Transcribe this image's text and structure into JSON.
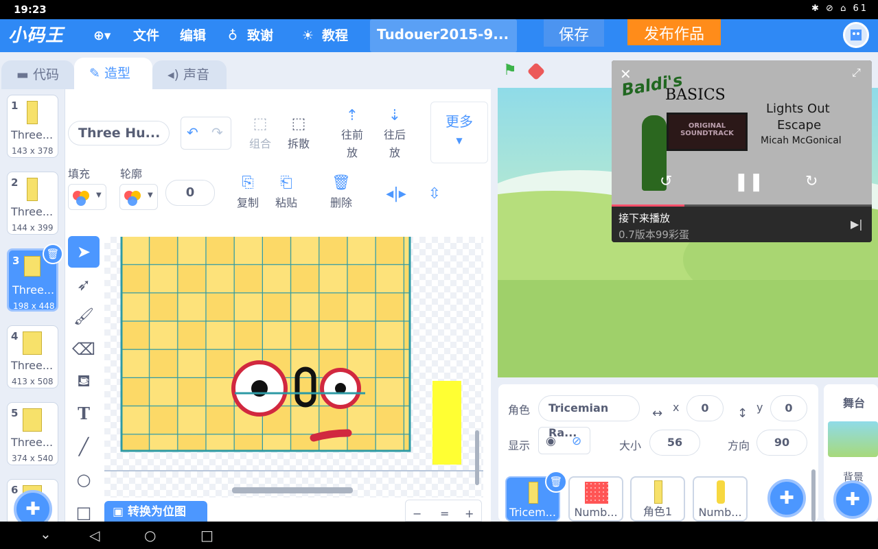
{
  "status": {
    "time": "19:23",
    "icons_text": "✱ ⊘ ⌂ 61"
  },
  "menu": {
    "logo": "小码王",
    "file": "文件",
    "edit": "编辑",
    "credits": "致谢",
    "tutorial": "教程",
    "project_title": "Tudouer2015-9...",
    "save": "保存",
    "publish": "发布作品"
  },
  "tabs": {
    "code": "代码",
    "costume": "造型",
    "sound": "声音"
  },
  "costumes": [
    {
      "num": "1",
      "name": "Three...",
      "size": "143 x 378"
    },
    {
      "num": "2",
      "name": "Three...",
      "size": "144 x 399"
    },
    {
      "num": "3",
      "name": "Three...",
      "size": "198 x 448"
    },
    {
      "num": "4",
      "name": "Three...",
      "size": "413 x 508"
    },
    {
      "num": "5",
      "name": "Three...",
      "size": "374 x 540"
    },
    {
      "num": "6",
      "name": "",
      "size": ""
    }
  ],
  "editor": {
    "costume_name": "Three Hu...",
    "group": "组合",
    "ungroup": "拆散",
    "forward": "往前",
    "backward": "往后",
    "put": "放",
    "more": "更多",
    "fill": "填充",
    "outline": "轮廓",
    "outline_width": "0",
    "copy": "复制",
    "paste": "粘贴",
    "delete": "删除",
    "convert": "转换为位图",
    "zoom_out": "−",
    "zoom_reset": "=",
    "zoom_in": "+"
  },
  "video": {
    "title_line1": "Baldi's",
    "title_line2": "BASICS",
    "soundtrack": "ORIGINAL SOUNDTRACK",
    "track_line1": "Lights Out",
    "track_line2": "Escape",
    "artist": "Micah McGonical",
    "up_next_label": "接下来播放",
    "up_next_title": "0.7版本99彩蛋",
    "progress": 0.28
  },
  "sprite_info": {
    "sprite_label": "角色",
    "sprite_name": "Tricemian Ra...",
    "x_label": "x",
    "x": "0",
    "y_label": "y",
    "y": "0",
    "show_label": "显示",
    "size_label": "大小",
    "size": "56",
    "direction_label": "方向",
    "direction": "90"
  },
  "sprites": [
    {
      "name": "Tricem..."
    },
    {
      "name": "Numb..."
    },
    {
      "name": "角色1"
    },
    {
      "name": "Numb..."
    }
  ],
  "stage_pane": {
    "title": "舞台",
    "backdrop": "背景"
  },
  "colors": {
    "accent": "#4c97ff",
    "menu": "#2f89f5",
    "publish": "#ff8c1a",
    "grid": "#2d9aa5",
    "tile": "#fde27a"
  }
}
